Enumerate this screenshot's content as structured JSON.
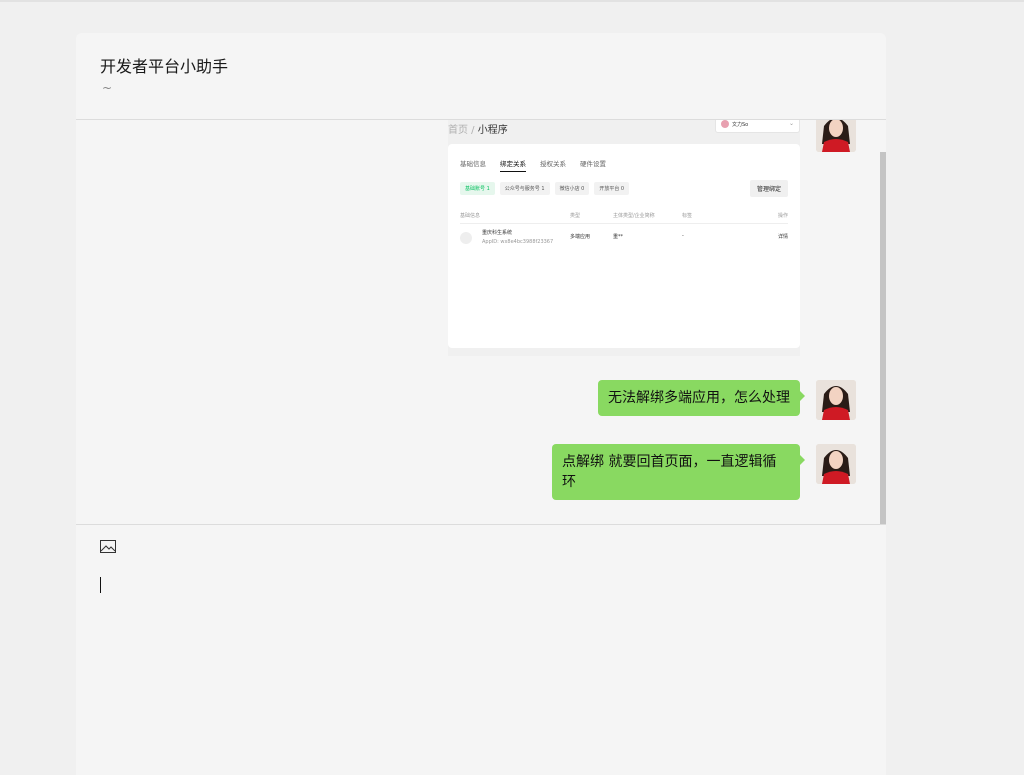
{
  "window": {
    "title": "开发者平台小助手",
    "subtitle": "~"
  },
  "screenshot_message": {
    "breadcrumb_home": "首页",
    "breadcrumb_sep": " / ",
    "breadcrumb_current": "小程序",
    "account_name": "文力So",
    "tabs": [
      "基础信息",
      "绑定关系",
      "授权关系",
      "硬件设置"
    ],
    "active_tab": "绑定关系",
    "chips": [
      "基础账号 1",
      "公众号与服务号 1",
      "微信小店 0",
      "开放平台 0"
    ],
    "manage_button": "管理绑定",
    "table_headers": [
      "基础信息",
      "类型",
      "主体类型/企业简称",
      "标签",
      "操作"
    ],
    "row": {
      "name": "重庆科生系统",
      "appid": "AppID: wx8e4bc3988f23367",
      "type": "多端应用",
      "subject": "重**",
      "tag": "-",
      "action": "详情"
    }
  },
  "messages": [
    {
      "text": "无法解绑多端应用，怎么处理"
    },
    {
      "text": "点解绑 就要回首页面，一直逻辑循环"
    }
  ],
  "input": {
    "image_button_icon": "image-icon",
    "value": ""
  },
  "colors": {
    "bubble": "#89d961",
    "accent": "#07c160"
  }
}
